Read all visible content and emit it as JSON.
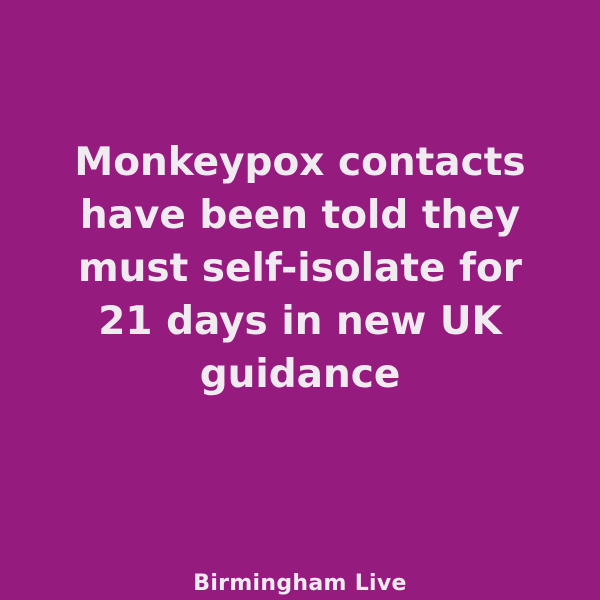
{
  "theme": {
    "background": "#961b7f",
    "text": "#f2eaf1"
  },
  "headline": {
    "lines": [
      "Monkeypox contacts",
      "have been told they",
      "must self-isolate for",
      "21 days in new UK",
      "guidance"
    ]
  },
  "brand": {
    "name": "Birmingham Live"
  }
}
